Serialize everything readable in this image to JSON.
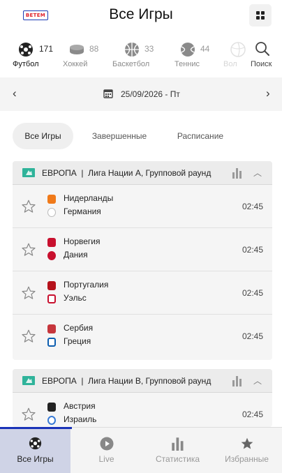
{
  "header": {
    "logo_text": "BETEM",
    "title": "Все Игры",
    "menu_icon": "grid-icon"
  },
  "sports": [
    {
      "name": "Футбол",
      "count": "171",
      "icon": "soccer-ball-icon"
    },
    {
      "name": "Хоккей",
      "count": "88",
      "icon": "hockey-puck-icon"
    },
    {
      "name": "Баскетбол",
      "count": "33",
      "icon": "basketball-icon"
    },
    {
      "name": "Теннис",
      "count": "44",
      "icon": "tennis-ball-icon"
    },
    {
      "name": "Вол",
      "count": "",
      "icon": "volleyball-icon"
    },
    {
      "name": "Поиск",
      "count": "",
      "icon": "search-icon"
    }
  ],
  "date_bar": {
    "prev": "‹",
    "next": "›",
    "date": "25/09/2026 - Пт"
  },
  "tabs": [
    {
      "label": "Все Игры",
      "active": true
    },
    {
      "label": "Завершенные",
      "active": false
    },
    {
      "label": "Расписание",
      "active": false
    }
  ],
  "groups": [
    {
      "region": "ЕВРОПА",
      "league": "Лига Нации А, Групповой раунд",
      "title": "ЕВРОПА  |  Лига Нации А, Групповой раунд",
      "matches": [
        {
          "home": "Нидерланды",
          "away": "Германия",
          "time": "02:45",
          "home_color": "#f07a1a",
          "away_color": "#cccccc"
        },
        {
          "home": "Норвегия",
          "away": "Дания",
          "time": "02:45",
          "home_color": "#c8102e",
          "away_color": "#c8102e"
        },
        {
          "home": "Португалия",
          "away": "Уэльс",
          "time": "02:45",
          "home_color": "#b5121b",
          "away_color": "#c8102e"
        },
        {
          "home": "Сербия",
          "away": "Греция",
          "time": "02:45",
          "home_color": "#c6363c",
          "away_color": "#0d5eaf"
        }
      ]
    },
    {
      "region": "ЕВРОПА",
      "league": "Лига Нации В, Групповой раунд",
      "title": "ЕВРОПА  |  Лига Нации В, Групповой раунд",
      "matches": [
        {
          "home": "Австрия",
          "away": "Израиль",
          "time": "02:45",
          "home_color": "#222222",
          "away_color": "#3a7bd5"
        }
      ]
    }
  ],
  "bottom_nav": [
    {
      "label": "Все Игры",
      "icon": "soccer-ball-icon",
      "active": true
    },
    {
      "label": "Live",
      "icon": "play-icon",
      "active": false
    },
    {
      "label": "Статистика",
      "icon": "bar-chart-icon",
      "active": false
    },
    {
      "label": "Избранные",
      "icon": "star-icon",
      "active": false
    }
  ],
  "colors": {
    "accent": "#1a33b8",
    "league_flag": "#2fb39a",
    "active_tab_bg": "#efefef",
    "active_nav_bg": "#cfd3e6"
  }
}
